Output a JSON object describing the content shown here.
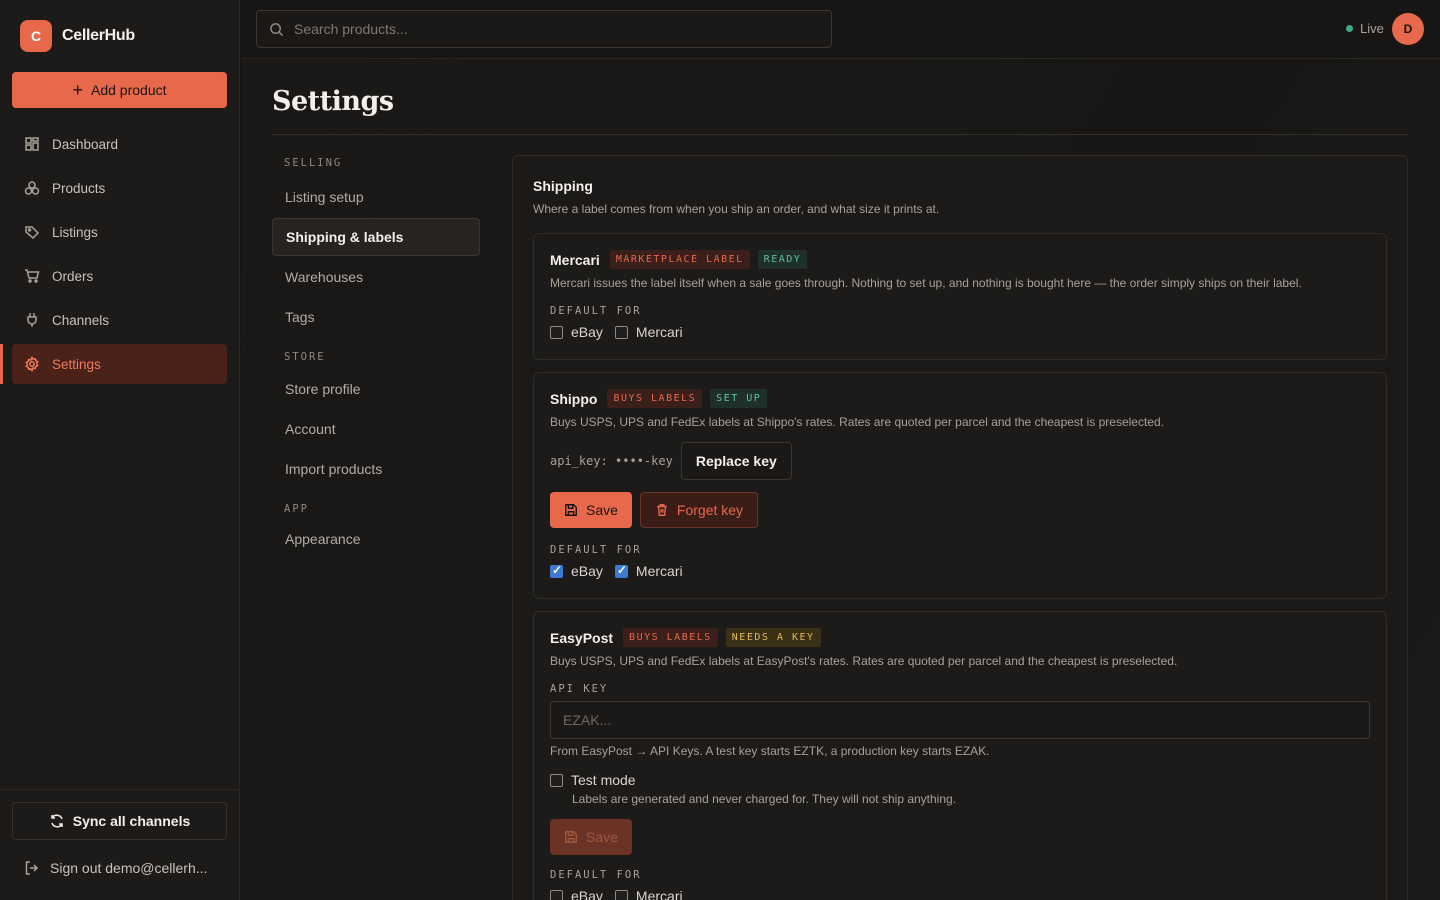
{
  "brand": {
    "logo_letter": "C",
    "name": "CellerHub"
  },
  "sidebar": {
    "add_label": "Add product",
    "items": [
      {
        "label": "Dashboard",
        "icon": "grid-icon"
      },
      {
        "label": "Products",
        "icon": "boxes-icon"
      },
      {
        "label": "Listings",
        "icon": "tag-icon"
      },
      {
        "label": "Orders",
        "icon": "cart-icon"
      },
      {
        "label": "Channels",
        "icon": "plug-icon"
      },
      {
        "label": "Settings",
        "icon": "gear-icon",
        "active": true
      }
    ],
    "sync_label": "Sync all channels",
    "signout_label": "Sign out demo@cellerh..."
  },
  "topbar": {
    "search_placeholder": "Search products...",
    "status_label": "Live",
    "status_color": "#3fa78a",
    "avatar_letter": "D"
  },
  "page": {
    "title": "Settings"
  },
  "settings_nav": {
    "selling_heading": "SELLING",
    "selling": [
      "Listing setup",
      "Shipping & labels",
      "Warehouses",
      "Tags"
    ],
    "store_heading": "STORE",
    "store": [
      "Store profile",
      "Account",
      "Import products"
    ],
    "app_heading": "APP",
    "app": [
      "Appearance"
    ],
    "active": "Shipping & labels"
  },
  "shipping": {
    "title": "Shipping",
    "description": "Where a label comes from when you ship an order, and what size it prints at.",
    "default_for_label": "DEFAULT FOR",
    "mercari": {
      "name": "Mercari",
      "tag1": "MARKETPLACE LABEL",
      "tag2": "READY",
      "description": "Mercari issues the label itself when a sale goes through. Nothing to set up, and nothing is bought here — the order simply ships on their label.",
      "defaults": [
        {
          "label": "eBay",
          "checked": false
        },
        {
          "label": "Mercari",
          "checked": false
        }
      ]
    },
    "shippo": {
      "name": "Shippo",
      "tag1": "BUYS LABELS",
      "tag2": "SET UP",
      "description": "Buys USPS, UPS and FedEx labels at Shippo's rates. Rates are quoted per parcel and the cheapest is preselected.",
      "key_text": "api_key: ••••-key",
      "replace_label": "Replace key",
      "save_label": "Save",
      "forget_label": "Forget key",
      "defaults": [
        {
          "label": "eBay",
          "checked": true
        },
        {
          "label": "Mercari",
          "checked": true
        }
      ]
    },
    "easypost": {
      "name": "EasyPost",
      "tag1": "BUYS LABELS",
      "tag2": "NEEDS A KEY",
      "description": "Buys USPS, UPS and FedEx labels at EasyPost's rates. Rates are quoted per parcel and the cheapest is preselected.",
      "api_key_label": "API KEY",
      "api_key_placeholder": "EZAK...",
      "hint": "From EasyPost → API Keys. A test key starts EZTK, a production key starts EZAK.",
      "test_mode_label": "Test mode",
      "test_mode_desc": "Labels are generated and never charged for. They will not ship anything.",
      "test_mode_checked": false,
      "save_label": "Save",
      "defaults": [
        {
          "label": "eBay",
          "checked": false
        },
        {
          "label": "Mercari",
          "checked": false
        }
      ]
    }
  },
  "colors": {
    "accent": "#e8684c",
    "ready": "#5fc0a0",
    "needs_key": "#e4b95a"
  }
}
